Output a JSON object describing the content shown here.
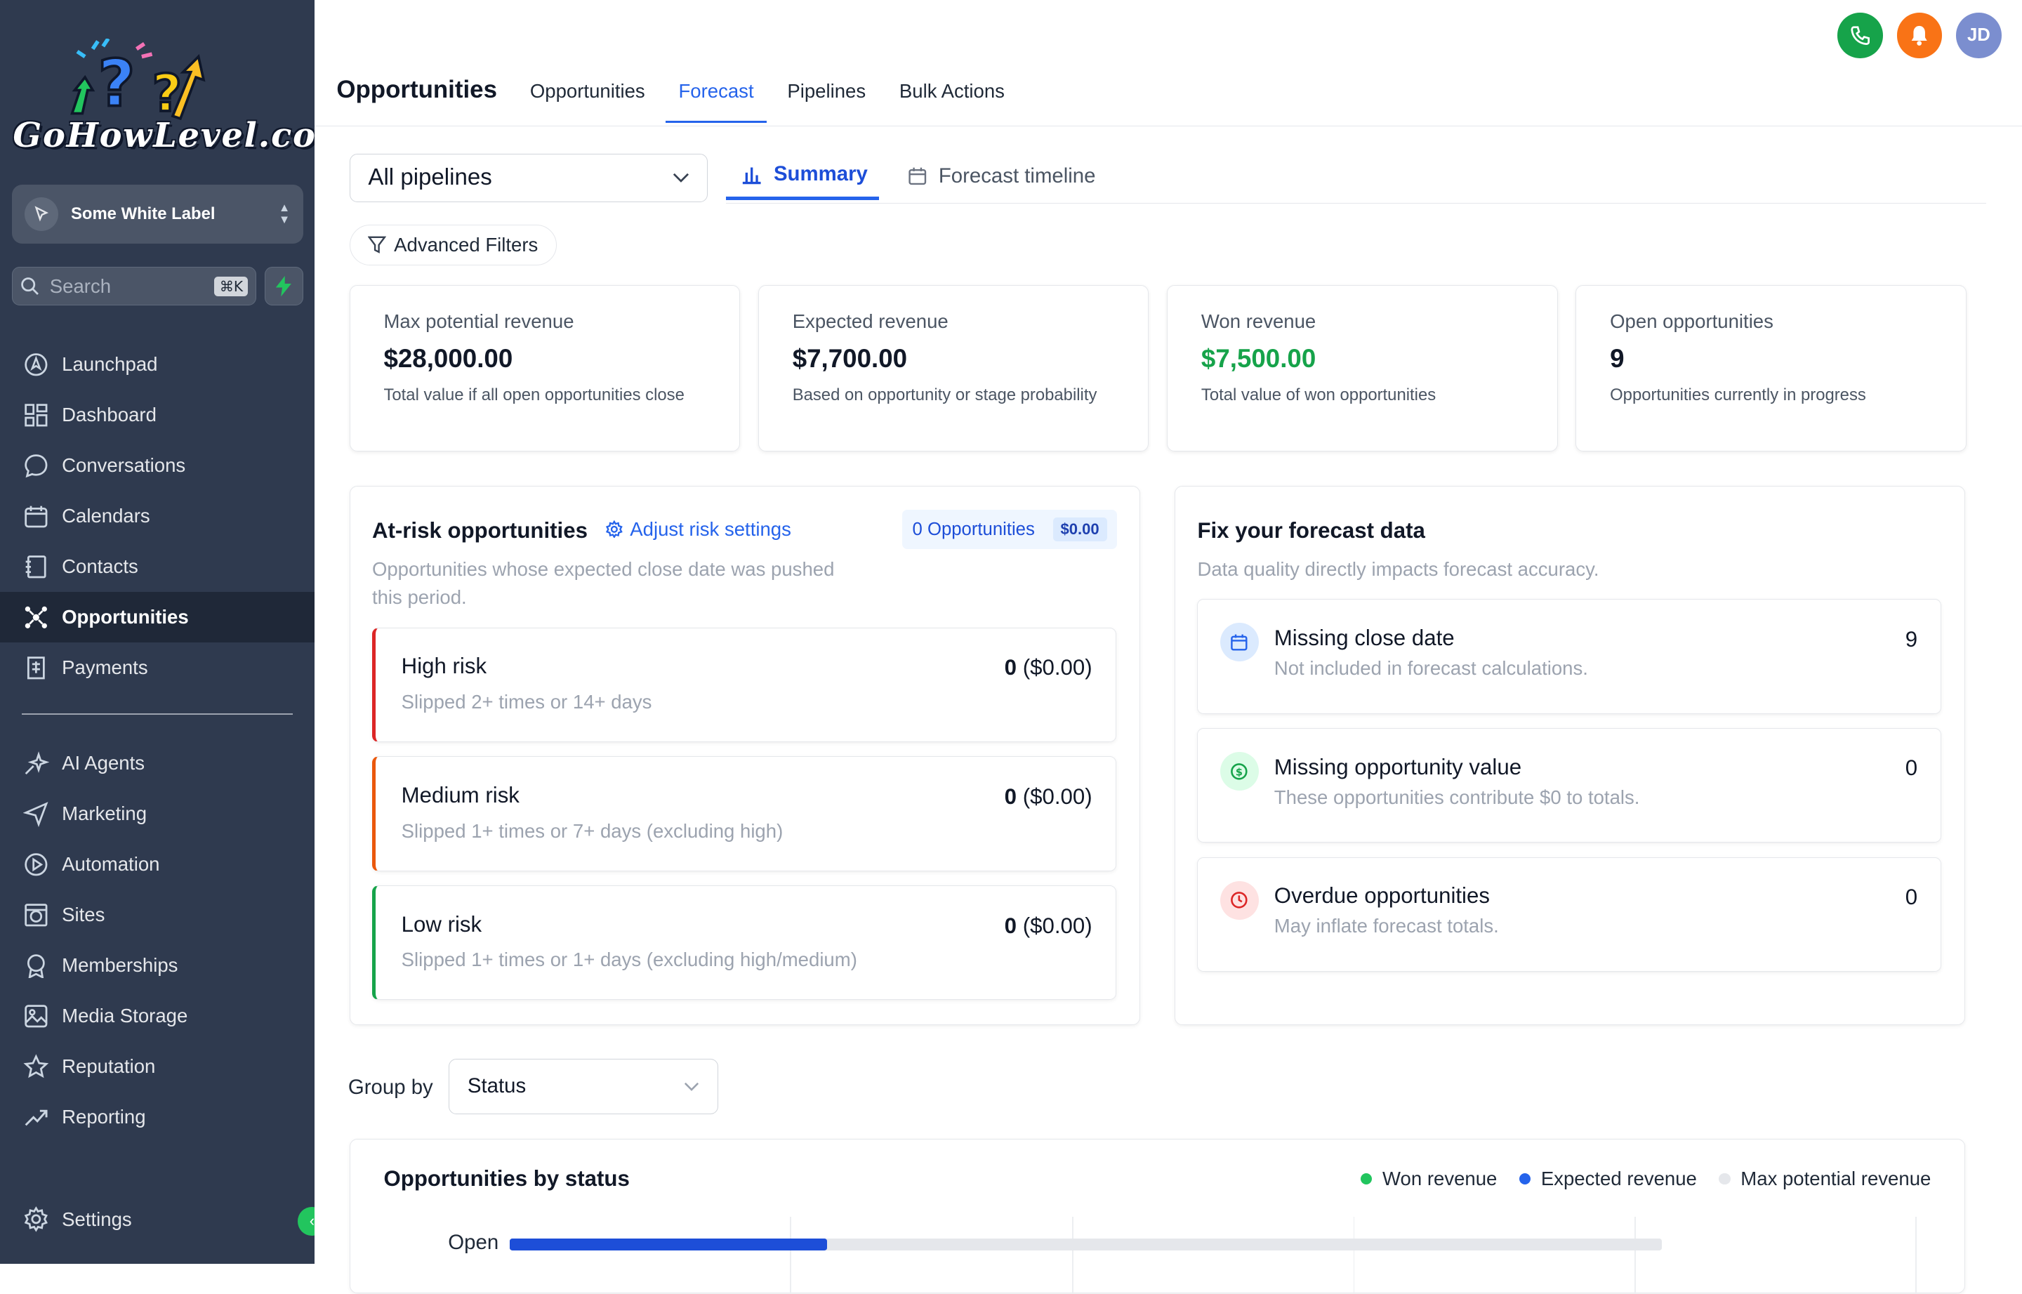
{
  "brand": {
    "logo_text": "GoHowLevel.com"
  },
  "account": {
    "name": "Some White Label"
  },
  "search": {
    "placeholder": "Search",
    "shortcut": "⌘K"
  },
  "sidebar": {
    "items": [
      {
        "label": "Launchpad",
        "icon": "rocket-icon"
      },
      {
        "label": "Dashboard",
        "icon": "grid-icon"
      },
      {
        "label": "Conversations",
        "icon": "chat-icon"
      },
      {
        "label": "Calendars",
        "icon": "calendar-icon"
      },
      {
        "label": "Contacts",
        "icon": "contacts-icon"
      },
      {
        "label": "Opportunities",
        "icon": "opportunities-icon",
        "active": true
      },
      {
        "label": "Payments",
        "icon": "receipt-icon"
      }
    ],
    "items2": [
      {
        "label": "AI Agents",
        "icon": "sparkle-icon"
      },
      {
        "label": "Marketing",
        "icon": "send-icon"
      },
      {
        "label": "Automation",
        "icon": "automation-icon"
      },
      {
        "label": "Sites",
        "icon": "globe-icon"
      },
      {
        "label": "Memberships",
        "icon": "badge-icon"
      },
      {
        "label": "Media Storage",
        "icon": "image-icon"
      },
      {
        "label": "Reputation",
        "icon": "star-icon"
      },
      {
        "label": "Reporting",
        "icon": "trend-icon"
      }
    ],
    "settings_label": "Settings"
  },
  "header": {
    "title": "Opportunities",
    "tabs": [
      {
        "label": "Opportunities"
      },
      {
        "label": "Forecast",
        "active": true
      },
      {
        "label": "Pipelines"
      },
      {
        "label": "Bulk Actions"
      }
    ],
    "avatar_initials": "JD"
  },
  "filters": {
    "pipeline_value": "All pipelines",
    "subtabs": [
      {
        "label": "Summary",
        "active": true
      },
      {
        "label": "Forecast timeline"
      }
    ],
    "advanced_filters_label": "Advanced Filters"
  },
  "stats": [
    {
      "label": "Max potential revenue",
      "value": "$28,000.00",
      "desc": "Total value if all open opportunities close"
    },
    {
      "label": "Expected revenue",
      "value": "$7,700.00",
      "desc": "Based on opportunity or stage probability"
    },
    {
      "label": "Won revenue",
      "value": "$7,500.00",
      "desc": "Total value of won opportunities"
    },
    {
      "label": "Open opportunities",
      "value": "9",
      "desc": "Opportunities currently in progress"
    }
  ],
  "at_risk": {
    "title": "At-risk opportunities",
    "adjust_label": "Adjust risk settings",
    "count_label": "0 Opportunities",
    "amount_label": "$0.00",
    "desc": "Opportunities whose expected close date was pushed this period.",
    "rows": [
      {
        "title": "High risk",
        "sub": "Slipped 2+ times or 14+ days",
        "count": "0",
        "amount": "($0.00)",
        "color": "#dc2626"
      },
      {
        "title": "Medium risk",
        "sub": "Slipped 1+ times or 7+ days (excluding high)",
        "count": "0",
        "amount": "($0.00)",
        "color": "#ea580c"
      },
      {
        "title": "Low risk",
        "sub": "Slipped 1+ times or 1+ days (excluding high/medium)",
        "count": "0",
        "amount": "($0.00)",
        "color": "#16a34a"
      }
    ]
  },
  "fix_forecast": {
    "title": "Fix your forecast data",
    "desc": "Data quality directly impacts forecast accuracy.",
    "rows": [
      {
        "title": "Missing close date",
        "sub": "Not included in forecast calculations.",
        "count": "9",
        "icon": "calendar-icon"
      },
      {
        "title": "Missing opportunity value",
        "sub": "These opportunities contribute $0 to totals.",
        "count": "0",
        "icon": "dollar-icon"
      },
      {
        "title": "Overdue opportunities",
        "sub": "May inflate forecast totals.",
        "count": "0",
        "icon": "clock-icon"
      }
    ]
  },
  "group_by": {
    "label": "Group by",
    "value": "Status"
  },
  "status_chart": {
    "title": "Opportunities by status",
    "legend": [
      {
        "label": "Won revenue",
        "color": "#22c55e"
      },
      {
        "label": "Expected revenue",
        "color": "#2563eb"
      },
      {
        "label": "Max potential revenue",
        "color": "#e5e7eb"
      }
    ]
  },
  "colors": {
    "sidebar_bg": "#2f3a4f",
    "accent": "#2563eb",
    "won_green": "#16a34a"
  },
  "chart_data": {
    "type": "bar",
    "orientation": "horizontal",
    "categories": [
      "Open"
    ],
    "series": [
      {
        "name": "Expected revenue",
        "values": [
          7700
        ]
      },
      {
        "name": "Max potential revenue",
        "values": [
          28000
        ]
      }
    ],
    "title": "Opportunities by status",
    "xlim": [
      0,
      28000
    ]
  }
}
